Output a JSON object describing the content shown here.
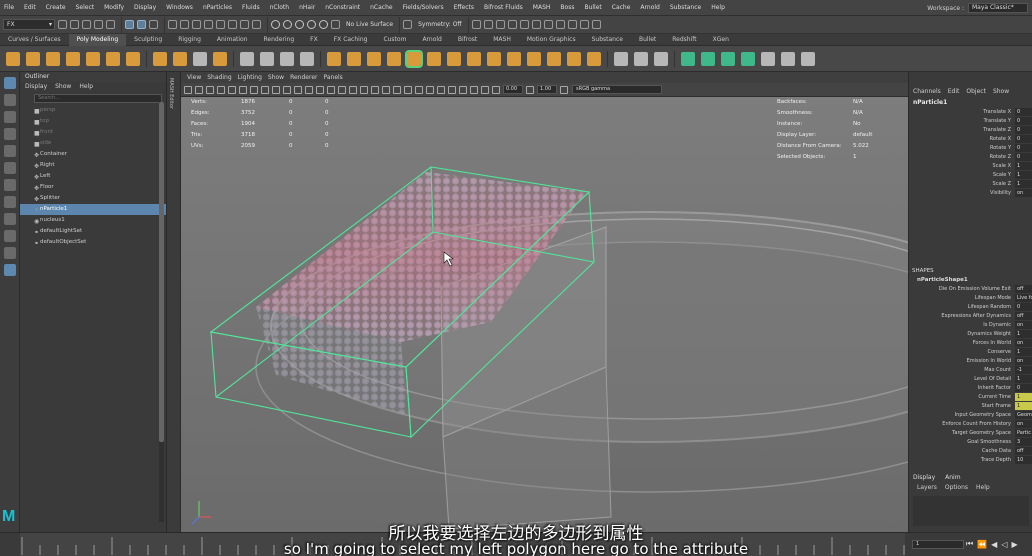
{
  "menubar": {
    "items": [
      "File",
      "Edit",
      "Create",
      "Select",
      "Modify",
      "Display",
      "Windows",
      "nParticles",
      "Fluids",
      "nCloth",
      "nHair",
      "nConstraint",
      "nCache",
      "Fields/Solvers",
      "Effects",
      "Bifrost Fluids",
      "MASH",
      "Boss",
      "Bullet",
      "Cache",
      "Arnold",
      "Substance",
      "Help"
    ],
    "workspace_label": "Workspace :",
    "workspace_value": "Maya Classic*"
  },
  "statusbar": {
    "mode": "FX",
    "live_surface": "No Live Surface",
    "symmetry": "Symmetry: Off"
  },
  "shelf": {
    "tabs": [
      "Curves / Surfaces",
      "Poly Modeling",
      "Sculpting",
      "Rigging",
      "Animation",
      "Rendering",
      "FX",
      "FX Caching",
      "Custom",
      "Arnold",
      "Bifrost",
      "MASH",
      "Motion Graphics",
      "Substance",
      "Bullet",
      "Redshift",
      "XGen"
    ],
    "active_tab": "Poly Modeling"
  },
  "outliner": {
    "title": "Outliner",
    "menu": [
      "Display",
      "Show",
      "Help"
    ],
    "search_placeholder": "Search...",
    "items": [
      {
        "label": "persp",
        "icon": "camera-icon",
        "dim": true,
        "sel": false,
        "kid": true
      },
      {
        "label": "top",
        "icon": "camera-icon",
        "dim": true,
        "sel": false,
        "kid": true
      },
      {
        "label": "front",
        "icon": "camera-icon",
        "dim": true,
        "sel": false,
        "kid": true
      },
      {
        "label": "side",
        "icon": "camera-icon",
        "dim": true,
        "sel": false,
        "kid": true
      },
      {
        "label": "Container",
        "icon": "transform-icon",
        "dim": false,
        "sel": false,
        "kid": true
      },
      {
        "label": "Right",
        "icon": "transform-icon",
        "dim": false,
        "sel": false,
        "kid": true
      },
      {
        "label": "Left",
        "icon": "transform-icon",
        "dim": false,
        "sel": false,
        "kid": true
      },
      {
        "label": "Floor",
        "icon": "transform-icon",
        "dim": false,
        "sel": false,
        "kid": true
      },
      {
        "label": "Splitter",
        "icon": "transform-icon",
        "dim": false,
        "sel": false,
        "kid": true
      },
      {
        "label": "nParticle1",
        "icon": "particle-icon",
        "dim": false,
        "sel": true,
        "kid": true
      },
      {
        "label": "nucleus1",
        "icon": "nucleus-icon",
        "dim": false,
        "sel": false,
        "kid": false
      },
      {
        "label": "defaultLightSet",
        "icon": "set-icon",
        "dim": false,
        "sel": false,
        "kid": false
      },
      {
        "label": "defaultObjectSet",
        "icon": "set-icon",
        "dim": false,
        "sel": false,
        "kid": false
      }
    ]
  },
  "mash_strip_label": "MASH Editor",
  "viewport": {
    "menu": [
      "View",
      "Shading",
      "Lighting",
      "Show",
      "Renderer",
      "Panels"
    ],
    "exposure": "0.00",
    "gamma": "1.00",
    "colorspace": "sRGB gamma",
    "hud_left": [
      {
        "label": "Verts:",
        "a": "1876",
        "b": "0",
        "c": "0"
      },
      {
        "label": "Edges:",
        "a": "3752",
        "b": "0",
        "c": "0"
      },
      {
        "label": "Faces:",
        "a": "1904",
        "b": "0",
        "c": "0"
      },
      {
        "label": "Tris:",
        "a": "3718",
        "b": "0",
        "c": "0"
      },
      {
        "label": "UVs:",
        "a": "2059",
        "b": "0",
        "c": "0"
      }
    ],
    "hud_right": [
      {
        "label": "Backfaces:",
        "value": "N/A"
      },
      {
        "label": "Smoothness:",
        "value": "N/A"
      },
      {
        "label": "Instance:",
        "value": "No"
      },
      {
        "label": "Display Layer:",
        "value": "default"
      },
      {
        "label": "Distance From Camera:",
        "value": "5.022"
      },
      {
        "label": "Selected Objects:",
        "value": "1"
      }
    ]
  },
  "channelbox": {
    "menu": [
      "Channels",
      "Edit",
      "Object",
      "Show"
    ],
    "object_name": "nParticle1",
    "transform_channels": [
      {
        "name": "Translate X",
        "value": "0"
      },
      {
        "name": "Translate Y",
        "value": "0"
      },
      {
        "name": "Translate Z",
        "value": "0"
      },
      {
        "name": "Rotate X",
        "value": "0"
      },
      {
        "name": "Rotate Y",
        "value": "0"
      },
      {
        "name": "Rotate Z",
        "value": "0"
      },
      {
        "name": "Scale X",
        "value": "1"
      },
      {
        "name": "Scale Y",
        "value": "1"
      },
      {
        "name": "Scale Z",
        "value": "1"
      },
      {
        "name": "Visibility",
        "value": "on"
      }
    ],
    "shapes_header": "SHAPES",
    "shape_name": "nParticleShape1",
    "shape_channels": [
      {
        "name": "Die On Emission Volume Exit",
        "value": "off",
        "key": false
      },
      {
        "name": "Lifespan Mode",
        "value": "Live fo",
        "key": false
      },
      {
        "name": "Lifespan Random",
        "value": "0",
        "key": false
      },
      {
        "name": "Expressions After Dynamics",
        "value": "off",
        "key": false
      },
      {
        "name": "Is Dynamic",
        "value": "on",
        "key": false
      },
      {
        "name": "Dynamics Weight",
        "value": "1",
        "key": false
      },
      {
        "name": "Forces In World",
        "value": "on",
        "key": false
      },
      {
        "name": "Conserve",
        "value": "1",
        "key": false
      },
      {
        "name": "Emission In World",
        "value": "on",
        "key": false
      },
      {
        "name": "Max Count",
        "value": "-1",
        "key": false
      },
      {
        "name": "Level Of Detail",
        "value": "1",
        "key": false
      },
      {
        "name": "Inherit Factor",
        "value": "0",
        "key": false
      },
      {
        "name": "Current Time",
        "value": "1",
        "key": true
      },
      {
        "name": "Start Frame",
        "value": "1",
        "key": true
      },
      {
        "name": "Input Geometry Space",
        "value": "Geom",
        "key": false
      },
      {
        "name": "Enforce Count From History",
        "value": "on",
        "key": false
      },
      {
        "name": "Target Geometry Space",
        "value": "Partic",
        "key": false
      },
      {
        "name": "Goal Smoothness",
        "value": "3",
        "key": false
      },
      {
        "name": "Cache Data",
        "value": "off",
        "key": false
      },
      {
        "name": "Trace Depth",
        "value": "10",
        "key": false
      }
    ],
    "layer_tabs": [
      "Display",
      "Anim"
    ],
    "layer_menu": [
      "Layers",
      "Options",
      "Help"
    ]
  },
  "timeline": {
    "current_frame": "1"
  },
  "subtitles": {
    "zh": "所以我要选择左边的多边形到属性",
    "en": "so I'm going to select my left polygon here go to the attribute"
  }
}
